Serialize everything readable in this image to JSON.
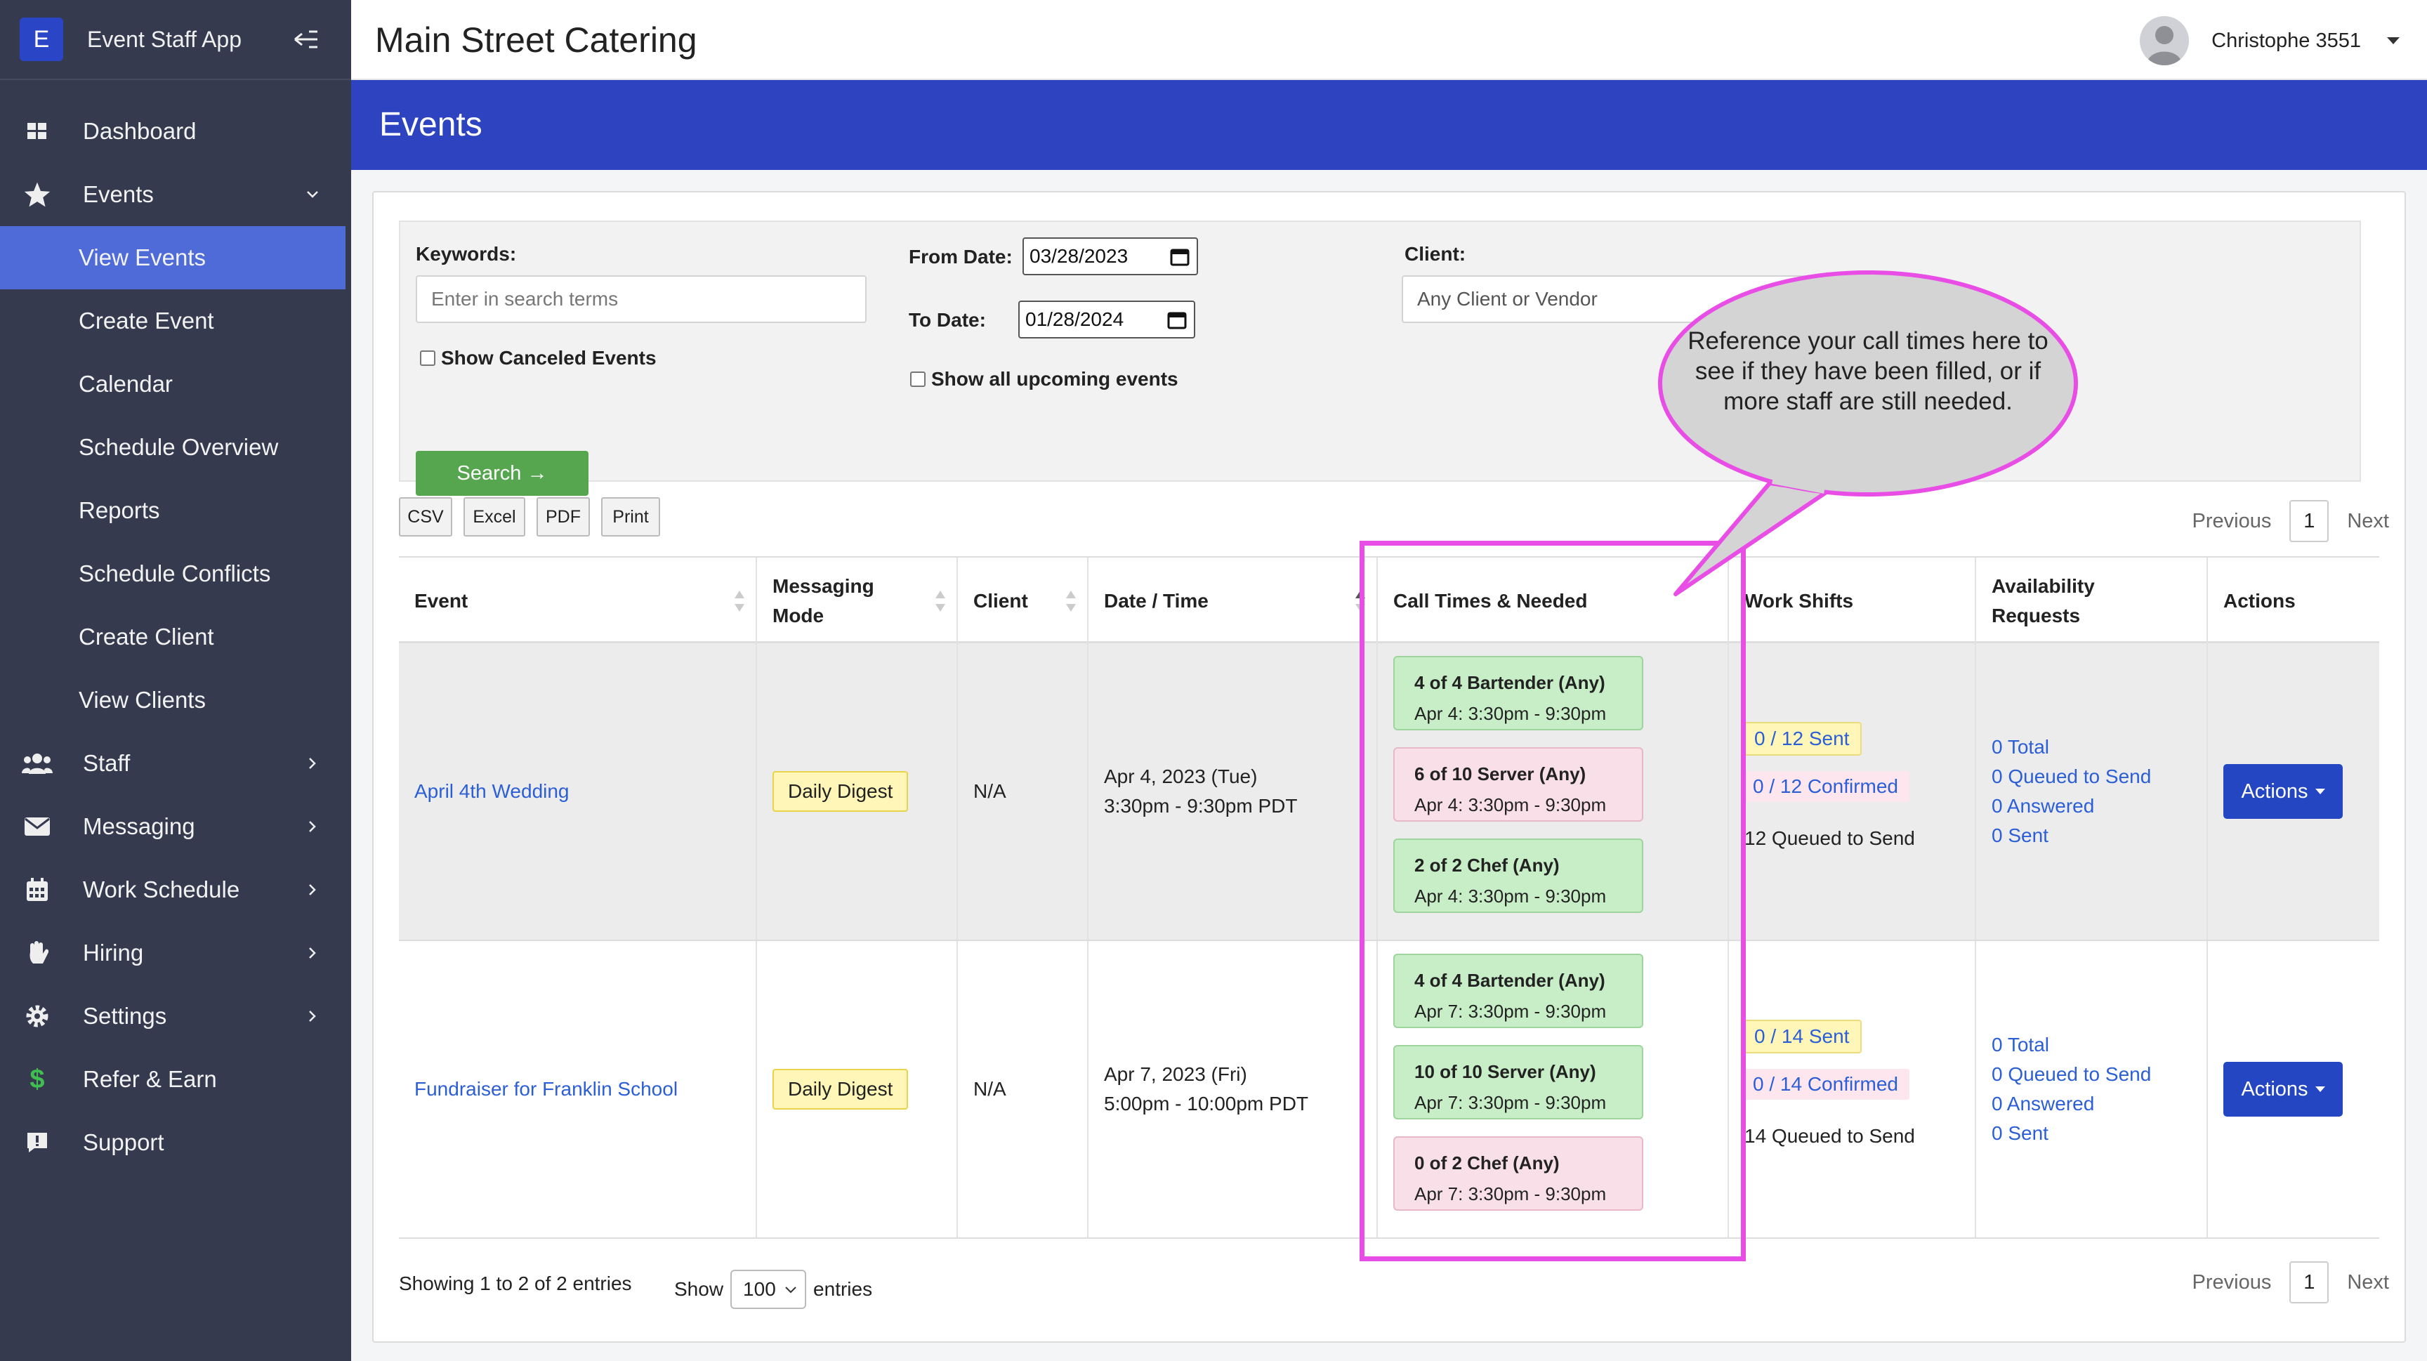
{
  "sidebar": {
    "brand_initial": "E",
    "brand_name": "Event Staff App",
    "items": [
      {
        "label": "Dashboard"
      },
      {
        "label": "Events"
      },
      {
        "label": "View Events"
      },
      {
        "label": "Create Event"
      },
      {
        "label": "Calendar"
      },
      {
        "label": "Schedule Overview"
      },
      {
        "label": "Reports"
      },
      {
        "label": "Schedule Conflicts"
      },
      {
        "label": "Create Client"
      },
      {
        "label": "View Clients"
      },
      {
        "label": "Staff"
      },
      {
        "label": "Messaging"
      },
      {
        "label": "Work Schedule"
      },
      {
        "label": "Hiring"
      },
      {
        "label": "Settings"
      },
      {
        "label": "Refer & Earn"
      },
      {
        "label": "Support"
      }
    ]
  },
  "header": {
    "title": "Main Street Catering",
    "user_name": "Christophe 3551"
  },
  "banner": {
    "title": "Events"
  },
  "filters": {
    "keywords_label": "Keywords:",
    "keywords_placeholder": "Enter in search terms",
    "show_canceled_label": "Show Canceled Events",
    "from_date_label": "From Date:",
    "from_date_value": "03/28/2023",
    "to_date_label": "To Date:",
    "to_date_value": "01/28/2024",
    "show_upcoming_label": "Show all upcoming events",
    "client_label": "Client:",
    "client_value": "Any Client or Vendor",
    "search_label": "Search →"
  },
  "export_buttons": [
    "CSV",
    "Excel",
    "PDF",
    "Print"
  ],
  "pagination": {
    "previous": "Previous",
    "page": "1",
    "next": "Next"
  },
  "table": {
    "headers": {
      "event": "Event",
      "messaging_mode_1": "Messaging",
      "messaging_mode_2": "Mode",
      "client": "Client",
      "date_time": "Date / Time",
      "call_times": "Call Times & Needed",
      "work_shifts": "Work Shifts",
      "availability_1": "Availability",
      "availability_2": "Requests",
      "actions": "Actions"
    },
    "rows": [
      {
        "event": "April 4th Wedding",
        "messaging_mode": "Daily Digest",
        "client": "N/A",
        "date": "Apr 4, 2023 (Tue)",
        "time": "3:30pm - 9:30pm PDT",
        "call_times": [
          {
            "title": "4 of 4 Bartender (Any)",
            "time": "Apr 4: 3:30pm - 9:30pm"
          },
          {
            "title": "6 of 10 Server (Any)",
            "time": "Apr 4: 3:30pm - 9:30pm"
          },
          {
            "title": "2 of 2 Chef (Any)",
            "time": "Apr 4: 3:30pm - 9:30pm"
          }
        ],
        "shifts_sent": "0 / 12 Sent",
        "shifts_confirmed": "0 / 12 Confirmed",
        "shifts_queued": "12 Queued to Send",
        "avail_total": "0 Total",
        "avail_queued": "0 Queued to Send",
        "avail_answered": "0 Answered",
        "avail_sent": "0 Sent",
        "actions_label": "Actions"
      },
      {
        "event": "Fundraiser for Franklin School",
        "messaging_mode": "Daily Digest",
        "client": "N/A",
        "date": "Apr 7, 2023 (Fri)",
        "time": "5:00pm - 10:00pm PDT",
        "call_times": [
          {
            "title": "4 of 4 Bartender (Any)",
            "time": "Apr 7: 3:30pm - 9:30pm"
          },
          {
            "title": "10 of 10 Server (Any)",
            "time": "Apr 7: 3:30pm - 9:30pm"
          },
          {
            "title": "0 of 2 Chef (Any)",
            "time": "Apr 7: 3:30pm - 9:30pm"
          }
        ],
        "shifts_sent": "0 / 14 Sent",
        "shifts_confirmed": "0 / 14 Confirmed",
        "shifts_queued": "14 Queued to Send",
        "avail_total": "0 Total",
        "avail_queued": "0 Queued to Send",
        "avail_answered": "0 Answered",
        "avail_sent": "0 Sent",
        "actions_label": "Actions"
      }
    ]
  },
  "footer": {
    "showing": "Showing 1 to 2 of 2 entries",
    "show_label": "Show",
    "page_size": "100",
    "entries_label": "entries"
  },
  "callout": {
    "text": "Reference your call times here to see if they have been filled, or if more staff are still needed."
  },
  "colors": {
    "sidebar_bg": "#353a4e",
    "active_item": "#4f6bd8",
    "banner": "#2d43c0",
    "search_button": "#56a64f",
    "actions_button": "#2446c2",
    "highlight": "#e84de6",
    "filled_call_time": "#c8eec7",
    "unfilled_call_time": "#f8dfe8"
  }
}
